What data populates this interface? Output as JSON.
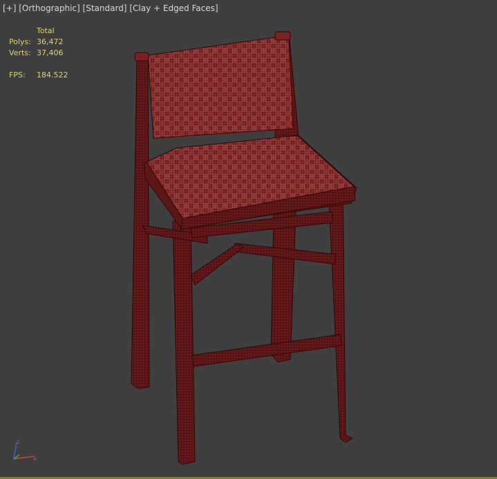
{
  "viewport": {
    "label_parts": [
      "[+]",
      "[Orthographic]",
      "[Standard]",
      "[Clay + Edged Faces]"
    ]
  },
  "stats": {
    "header": "Total",
    "polys_label": "Polys:",
    "polys_value": "36,472",
    "verts_label": "Verts:",
    "verts_value": "37,406",
    "fps_label": "FPS:",
    "fps_value": "184.522"
  },
  "gizmo": {
    "z_label": "z",
    "x_label": "x"
  },
  "colors": {
    "background": "#3f3f3f",
    "stats_text": "#e0d070",
    "label_text": "#d8d8d8",
    "clay_fill": "#7a2424",
    "clay_light": "#b04848",
    "wire": "#3a0a0a"
  },
  "scene_object": "bar-stool-wireframe-icon"
}
